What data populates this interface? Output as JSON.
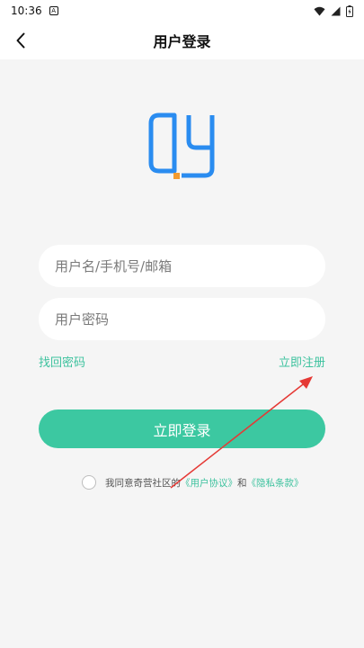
{
  "status_bar": {
    "time": "10:36",
    "a_indicator": "A",
    "icons": [
      "wifi-icon",
      "signal-icon",
      "battery-icon"
    ]
  },
  "header": {
    "title": "用户登录",
    "back_icon": "chevron-left-icon"
  },
  "logo": {
    "icon": "app-logo-icon",
    "colors": {
      "blue": "#2a8cf0",
      "orange": "#f39b2f"
    }
  },
  "form": {
    "username_placeholder": "用户名/手机号/邮箱",
    "password_placeholder": "用户密码",
    "forgot_password": "找回密码",
    "register": "立即注册",
    "login_button": "立即登录"
  },
  "agreement": {
    "prefix": "我同意奇营社区的",
    "user_agreement": "《用户协议》",
    "and": "和",
    "privacy_policy": "《隐私条款》"
  },
  "colors": {
    "accent": "#3cc8a1",
    "link": "#3dc29e",
    "background": "#f5f5f5",
    "annotation": "#e53935"
  }
}
